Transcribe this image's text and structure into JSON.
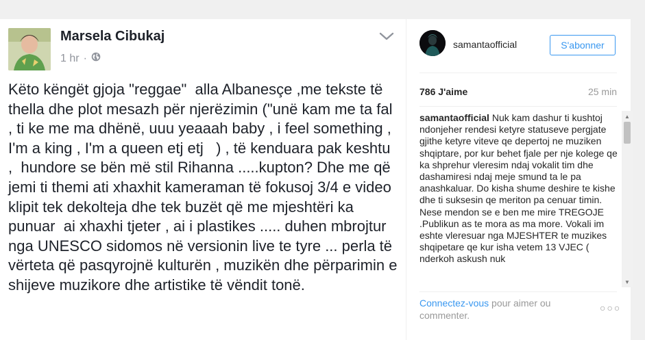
{
  "facebook_post": {
    "author": "Marsela Cibukaj",
    "timestamp": "1 hr",
    "separator": "·",
    "privacy_icon": "globe-icon",
    "menu_icon": "chevron-down-icon",
    "text": "Këto këngët gjoja \"reggae\"  alla Albanesçe ,me tekste të thella dhe plot mesazh për njerëzimin (\"unë kam me ta fal , ti ke me ma dhënë, uuu yeaaah baby , i feel something , I'm a king , I'm a queen etj etj   ) , të kenduara pak keshtu ,  hundore se bën më stil Rihanna .....kupton? Dhe me që jemi ti themi ati xhaxhit kameraman të fokusoj 3/4 e video klipit tek dekolteja dhe tek buzët që me mjeshtëri ka punuar  ai xhaxhi tjeter , ai i plastikes ..... duhen mbrojtur nga UNESCO sidomos në versionin live te tyre ... perla të vërteta që pasqyrojnë kulturën , muzikën dhe përparimin e shijeve muzikore dhe artistike të vëndit tonë."
  },
  "instagram_post": {
    "username": "samantaofficial",
    "follow_button": "S'abonner",
    "likes": "786 J'aime",
    "time_ago": "25 min",
    "caption_username": "samantaofficial",
    "caption_text": "Nuk kam dashur ti kushtoj ndonjeher rendesi ketyre statuseve pergjate gjithe ketyre viteve qe depertoj ne muziken shqiptare, por kur behet fjale per nje kolege qe ka shprehur vleresim ndaj vokalit tim dhe dashamiresi ndaj meje smund ta le pa anashkaluar. Do kisha shume deshire te kishe dhe ti suksesin qe meriton pa cenuar timin. Nese mendon se e ben me mire TREGOJE .Publikun as te mora as ma more. Vokali im eshte vleresuar nga MJESHTER te muzikes shqipetare qe kur isha vetem 13 VJEC ( nderkoh askush nuk",
    "login_link": "Connectez-vous",
    "login_rest": " pour aimer ou commenter.",
    "more_icon": "ellipsis-icon",
    "scroll_up_icon": "scroll-up-arrow-icon",
    "scroll_down_icon": "scroll-down-arrow-icon"
  },
  "colors": {
    "instagram_blue": "#3897f0",
    "facebook_text": "#1d2129",
    "muted_gray": "#90949c",
    "page_background": "#f0f0f0"
  }
}
